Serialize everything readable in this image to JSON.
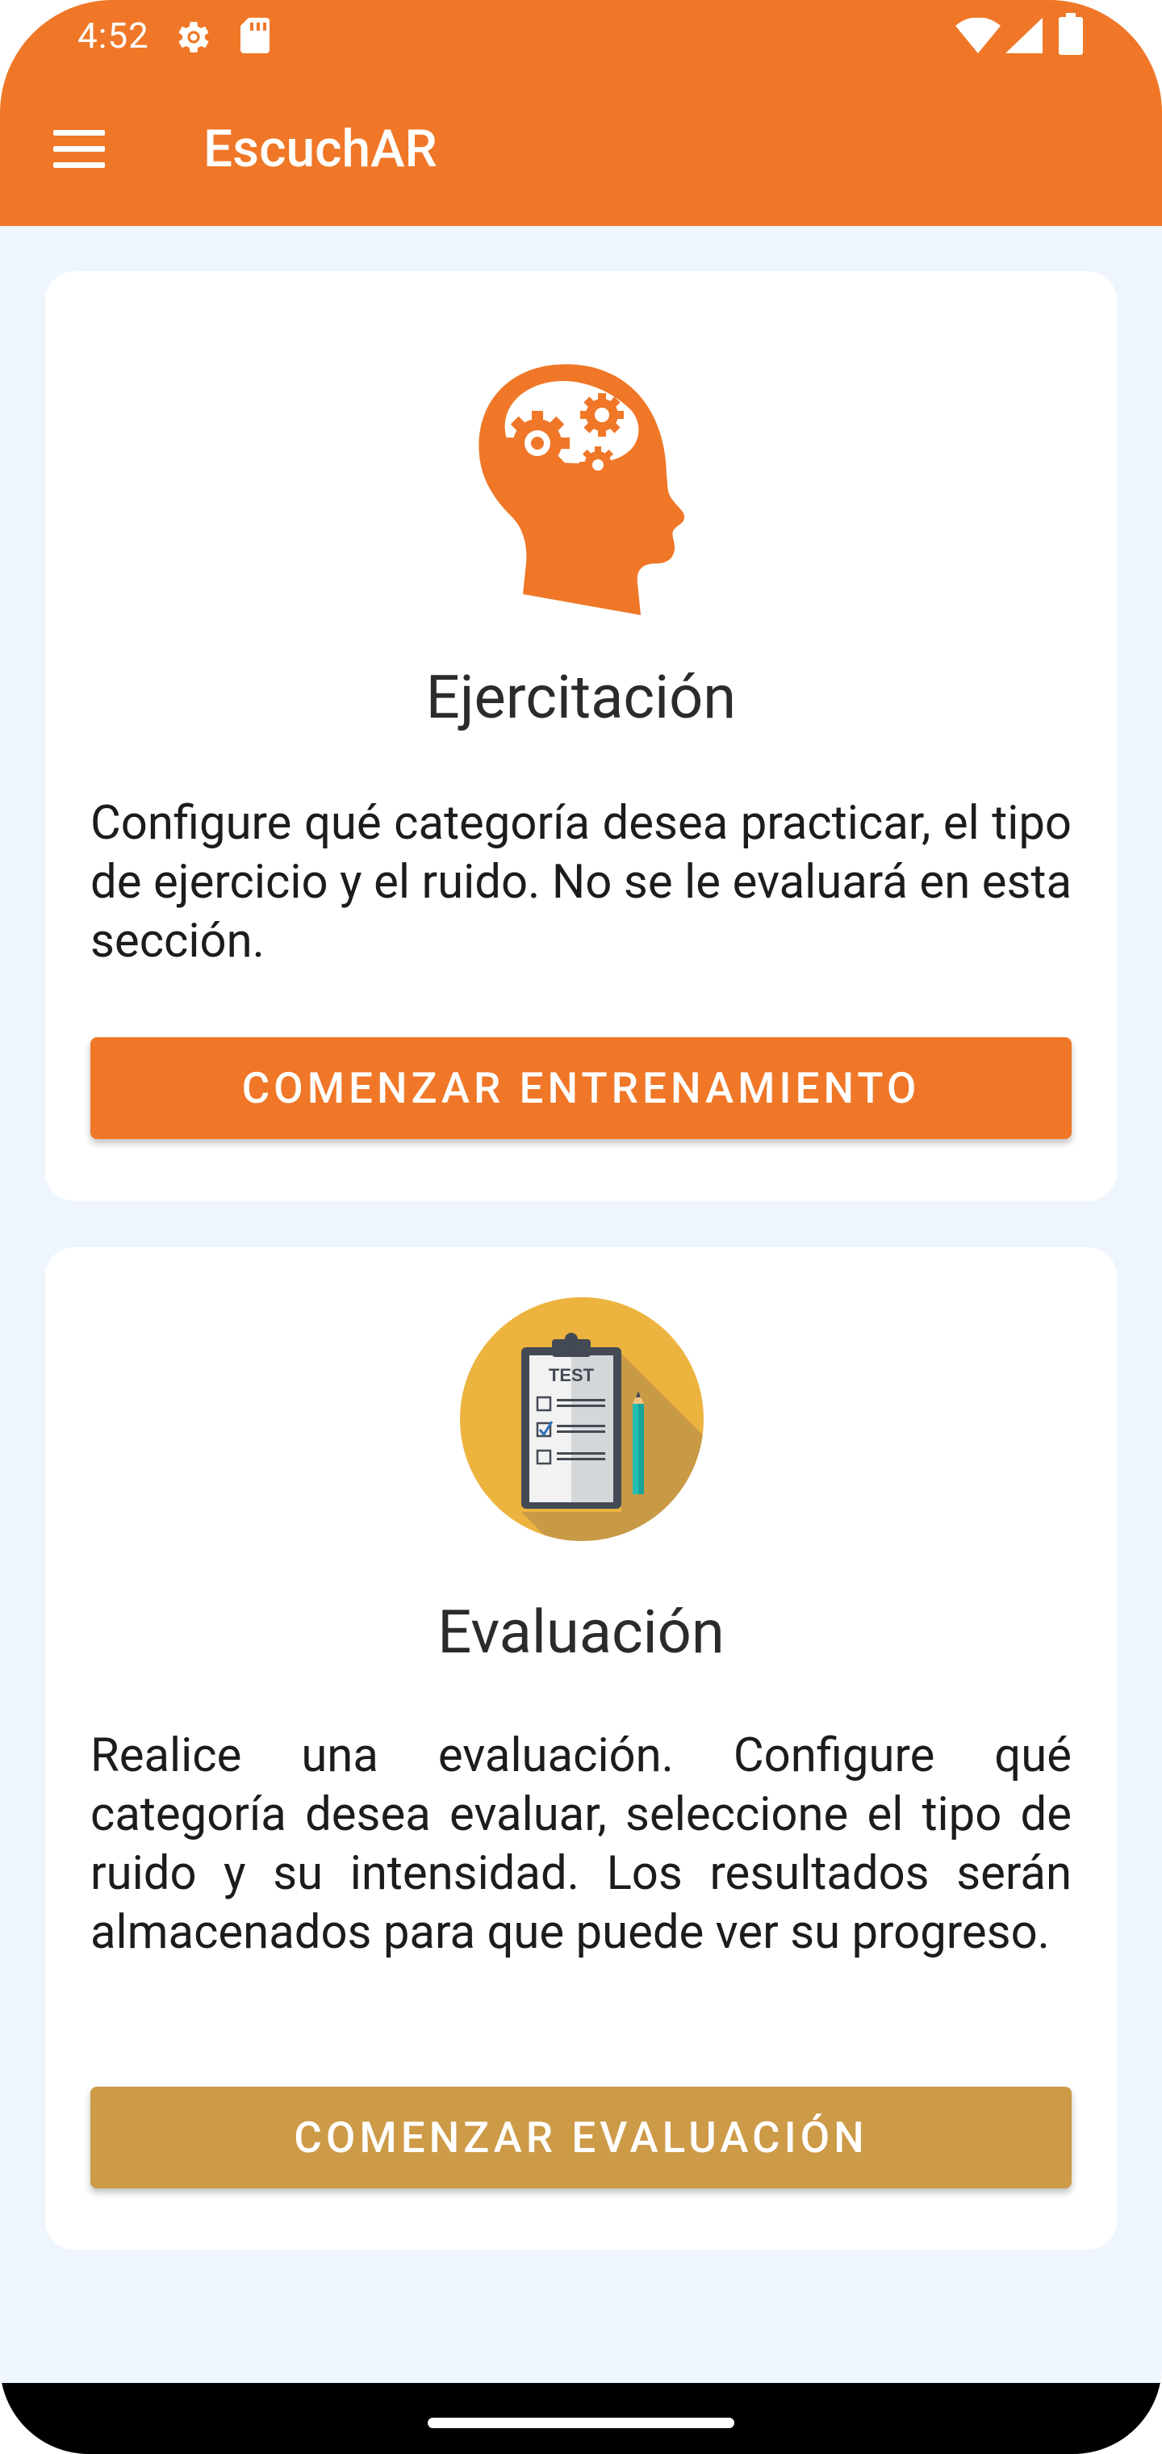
{
  "status_bar": {
    "time": "4:52",
    "icons": [
      "settings-gear-icon",
      "sd-card-icon",
      "wifi-icon",
      "signal-icon",
      "battery-icon"
    ]
  },
  "app_bar": {
    "title": "EscuchAR",
    "menu_icon": "hamburger-menu-icon",
    "background_color": "#ef7727"
  },
  "cards": {
    "training": {
      "icon": "head-gears-icon",
      "title": "Ejercitación",
      "description": "Configure qué categoría desea practicar, el tipo de ejercicio y el ruido. No se le evaluará en esta sección.",
      "button_label": "COMENZAR ENTRENAMIENTO",
      "button_color": "#ef7727"
    },
    "evaluation": {
      "icon": "test-clipboard-icon",
      "title": "Evaluación",
      "description": "Realice una evaluación. Configure qué categoría desea evaluar, seleccione el tipo de ruido y su intensidad. Los resultados serán almacenados para que puede ver su progreso.",
      "button_label": "COMENZAR EVALUACIÓN",
      "button_color": "#cd9a47"
    }
  },
  "colors": {
    "background": "#eef5fc",
    "accent_orange": "#ef7727",
    "accent_gold": "#cd9a47",
    "icon_circle": "#ecb33f"
  }
}
